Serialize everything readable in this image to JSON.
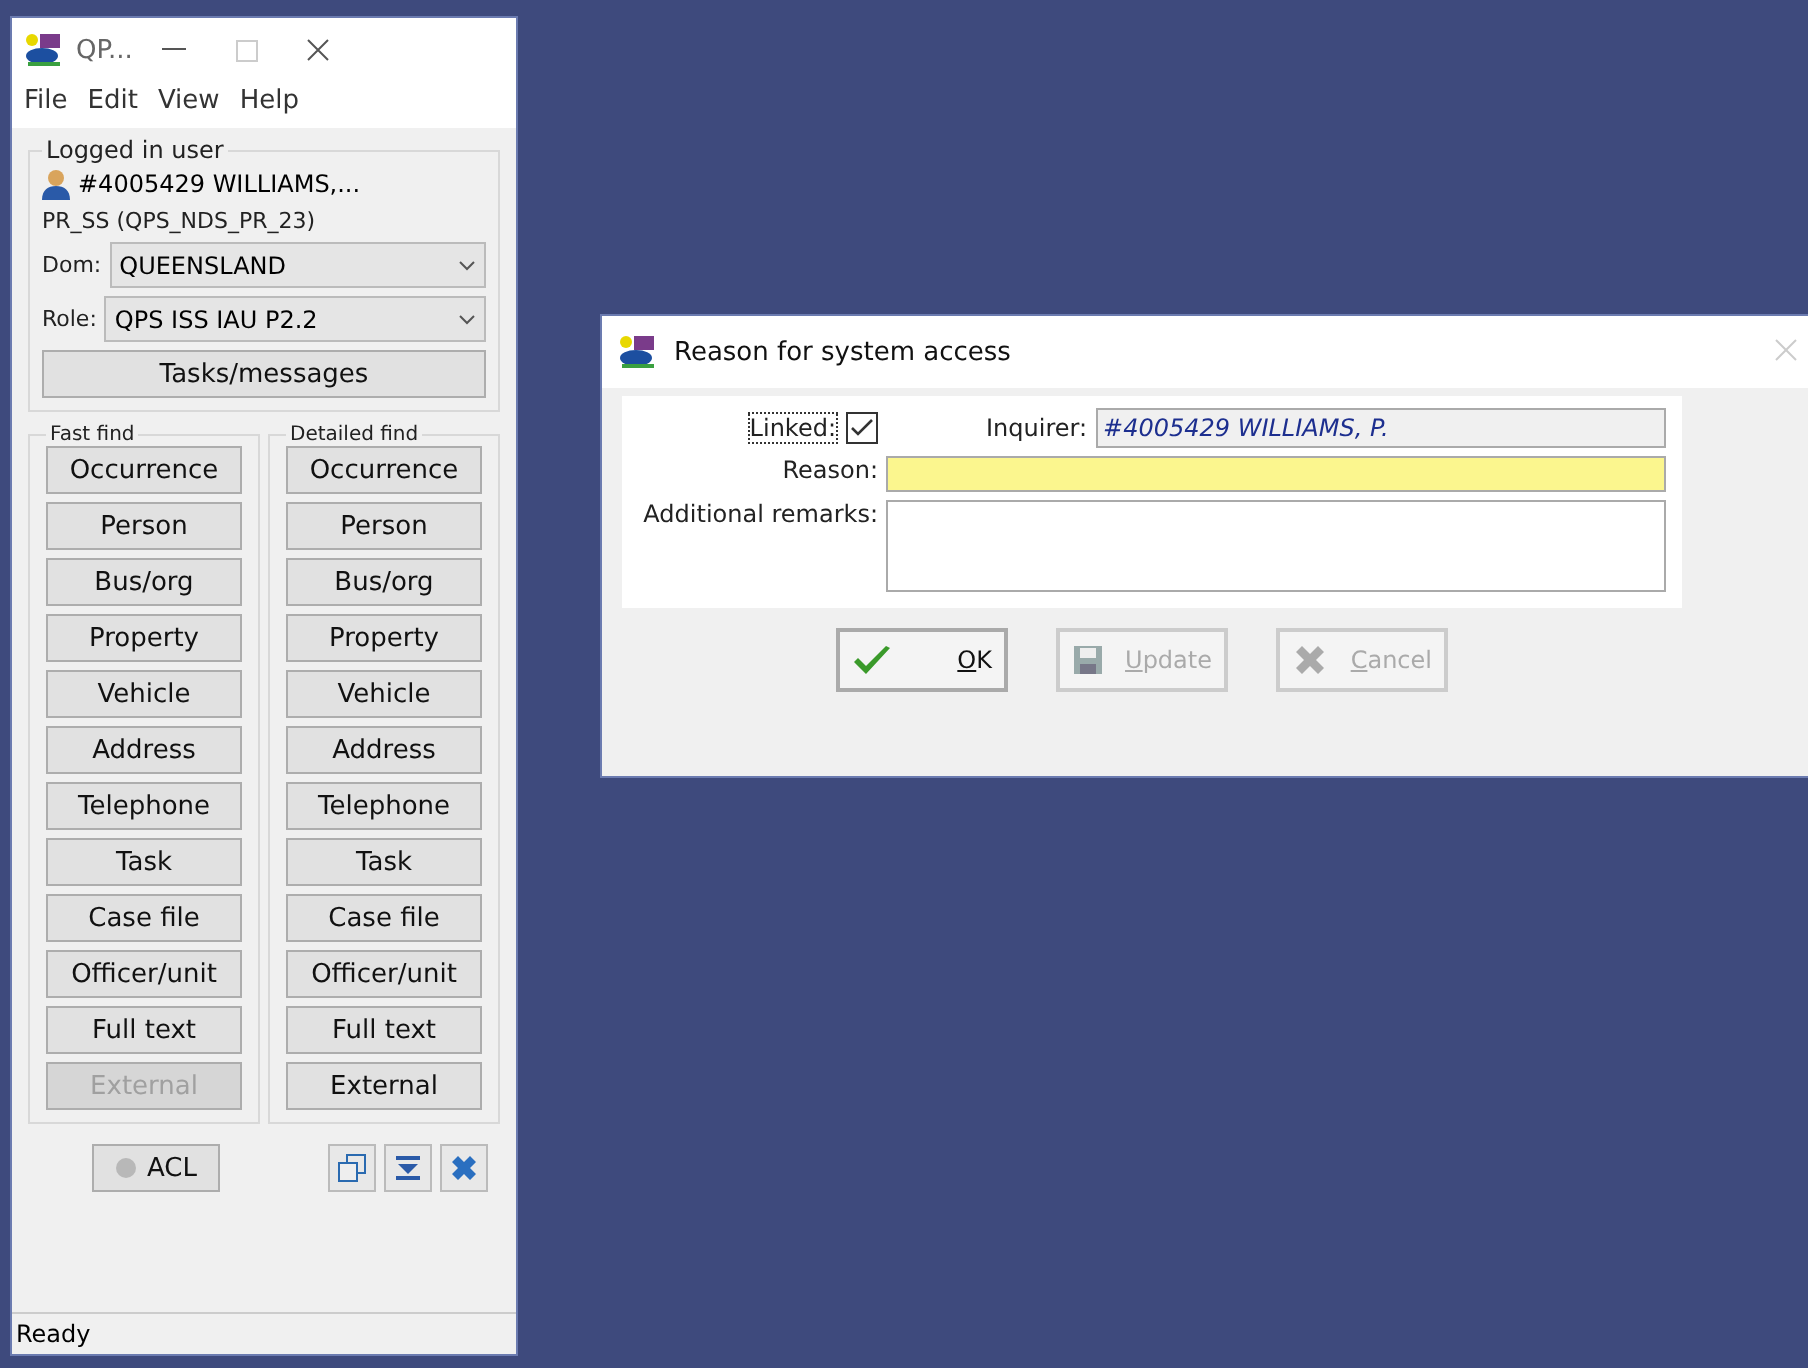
{
  "main_window": {
    "title": "QP...",
    "menu": [
      "File",
      "Edit",
      "View",
      "Help"
    ],
    "logged_in": {
      "legend": "Logged in user",
      "user": "#4005429 WILLIAMS,...",
      "profile": "PR_SS (QPS_NDS_PR_23)"
    },
    "selects": [
      {
        "label": "Dom:",
        "value": "QUEENSLAND"
      },
      {
        "label": "Role:",
        "value": "QPS ISS IAU P2.2"
      }
    ],
    "tasks_button": "Tasks/messages",
    "find_groups": [
      {
        "legend": "Fast find",
        "buttons": [
          {
            "label": "Occurrence",
            "disabled": false
          },
          {
            "label": "Person",
            "disabled": false
          },
          {
            "label": "Bus/org",
            "disabled": false
          },
          {
            "label": "Property",
            "disabled": false
          },
          {
            "label": "Vehicle",
            "disabled": false
          },
          {
            "label": "Address",
            "disabled": false
          },
          {
            "label": "Telephone",
            "disabled": false
          },
          {
            "label": "Task",
            "disabled": false
          },
          {
            "label": "Case file",
            "disabled": false
          },
          {
            "label": "Officer/unit",
            "disabled": false
          },
          {
            "label": "Full text",
            "disabled": false
          },
          {
            "label": "External",
            "disabled": true
          }
        ]
      },
      {
        "legend": "Detailed find",
        "buttons": [
          {
            "label": "Occurrence",
            "disabled": false
          },
          {
            "label": "Person",
            "disabled": false
          },
          {
            "label": "Bus/org",
            "disabled": false
          },
          {
            "label": "Property",
            "disabled": false
          },
          {
            "label": "Vehicle",
            "disabled": false
          },
          {
            "label": "Address",
            "disabled": false
          },
          {
            "label": "Telephone",
            "disabled": false
          },
          {
            "label": "Task",
            "disabled": false
          },
          {
            "label": "Case file",
            "disabled": false
          },
          {
            "label": "Officer/unit",
            "disabled": false
          },
          {
            "label": "Full text",
            "disabled": false
          },
          {
            "label": "External",
            "disabled": false
          }
        ]
      }
    ],
    "acl_button": "ACL",
    "status_bar": "Ready"
  },
  "dialog": {
    "title": "Reason for system access",
    "linked": {
      "label": "Linked:",
      "checked": true
    },
    "inquirer": {
      "label": "Inquirer:",
      "value": "#4005429 WILLIAMS, P."
    },
    "reason": {
      "label": "Reason:"
    },
    "remarks": {
      "label": "Additional remarks:"
    },
    "buttons": [
      {
        "kind": "ok",
        "label": "OK",
        "disabled": false
      },
      {
        "kind": "update",
        "label": "Update",
        "disabled": true
      },
      {
        "kind": "cancel",
        "label": "Cancel",
        "disabled": true
      }
    ]
  }
}
